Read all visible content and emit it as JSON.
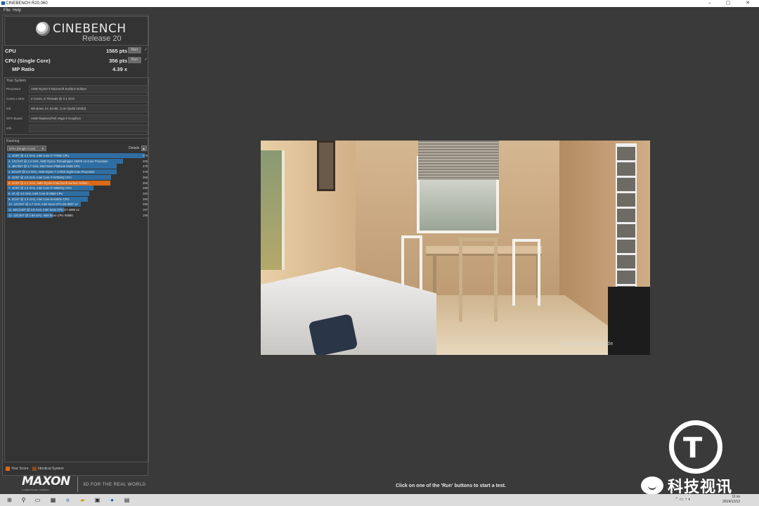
{
  "window": {
    "title": "CINEBENCH R20.060"
  },
  "menu": {
    "file": "File",
    "help": "Help"
  },
  "logo": {
    "brand": "CINEBENCH",
    "release": "Release 20"
  },
  "scores": [
    {
      "label": "CPU",
      "value": "1565 pts",
      "run": "Run",
      "check": "✓"
    },
    {
      "label": "CPU (Single Core)",
      "value": "356 pts",
      "run": "Run",
      "check": "✓"
    },
    {
      "label": "MP Ratio",
      "value": "4.39 x"
    }
  ],
  "system": {
    "header": "Your System",
    "rows": [
      {
        "key": "Processor",
        "value": "AMD Ryzen 5 Microsoft Surface Edition"
      },
      {
        "key": "Cores x GHz",
        "value": "4 Cores, 8 Threads @ 2.1 GHz"
      },
      {
        "key": "OS",
        "value": "Windows 10, 64 Bit, Core (build 18363)"
      },
      {
        "key": "GFX Board",
        "value": "AMD Radeon(TM) Vega 9 Graphics"
      },
      {
        "key": "Info",
        "value": ""
      }
    ]
  },
  "ranking": {
    "header": "Ranking",
    "select": "CPU (Single Core)",
    "details_label": "Details",
    "rows": [
      {
        "label": "1. 4C/8T @ 4.2 GHz, Intel Core i7-7700K CPU",
        "score": 476,
        "mine": false
      },
      {
        "label": "2. 12C/24T @ 3.4 GHz, AMD Ryzen Threadripper 1920X 12-Core Processor",
        "score": 400,
        "mine": false
      },
      {
        "label": "3. 48C/96T @ 2.7 GHz, Intel Xeon Platinum 8168 CPU",
        "score": 379,
        "mine": false
      },
      {
        "label": "4. 8C/16T @ 3.4 GHz, AMD Ryzen 7 1700X Eight-Core Processor",
        "score": 378,
        "mine": false
      },
      {
        "label": "5. 4C/8T @ 2.6 GHz, Intel Core i7-6700HQ CPU",
        "score": 359,
        "mine": false
      },
      {
        "label": "6. 4C/8T @ 2.1 GHz, AMD Ryzen 5 Microsoft Surface Edition",
        "score": 356,
        "mine": true
      },
      {
        "label": "7. 4C/8T @ 2.3 GHz, Intel Core i7-4850HQ CPU",
        "score": 298,
        "mine": false
      },
      {
        "label": "8. 4C @ 3.3 GHz, Intel Core i5-3550 CPU",
        "score": 283,
        "mine": false
      },
      {
        "label": "9. 2C/4T @ 2.3 GHz, Intel Core i5-5300U CPU",
        "score": 280,
        "mine": false
      },
      {
        "label": "10. 12C/24T @ 2.7 GHz, Intel Xeon CPU E5-2697 v2",
        "score": 255,
        "mine": false
      },
      {
        "label": "11. 60C/120T @ 2.8 GHz, Intel Xeon CPU E7-4890 v2",
        "score": 197,
        "mine": false
      },
      {
        "label": "12. 12C/24T @ 2.66 GHz, Intel Xeon CPU X5650",
        "score": 159,
        "mine": false
      }
    ],
    "max_score": 476
  },
  "legend": {
    "your_score": "Your Score",
    "identical": "Identical System"
  },
  "render": {
    "watermark": "www.renderbaron.de"
  },
  "status": "Click on one of the 'Run' buttons to start a test.",
  "footer": {
    "brand": "MAXON",
    "brand_sub": "A NEMETSCHEK COMPANY",
    "tagline": "3D FOR THE REAL WORLD"
  },
  "watermark": {
    "text": "科技视讯"
  },
  "taskbar": {
    "time": "11:xx",
    "date": "2019/12/12"
  },
  "colors": {
    "bar": "#2e6ea3",
    "mine": "#d96a1c",
    "identical": "#8a4a1a"
  }
}
